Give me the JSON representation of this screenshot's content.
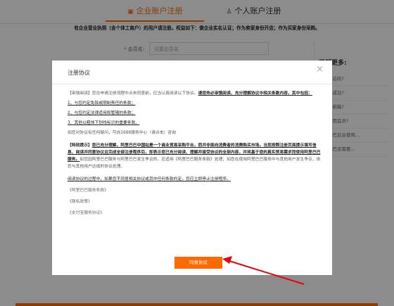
{
  "tabs": {
    "enterprise": "企业账户注册",
    "personal": "个人账户注册"
  },
  "notice": "有企业营业执照（含个体工商户）的用户请注册。权益如下：做企业实名认证；作为卖家身份开店；作为买家身份采购。",
  "form": {
    "required_mark": "*",
    "member_label": "会员名:",
    "member_placeholder": "设置会员名"
  },
  "sidebar": {
    "title": "了解更多:",
    "items": [
      "如何验证码?",
      "注册不成功?",
      "已填写邮箱?",
      "如何使用会员?",
      "阿里巴巴后台使用...",
      "阿里巴巴还需要..."
    ]
  },
  "modal": {
    "title": "注册协议",
    "close": "×",
    "p1_lead": "【审慎阅读】您在申请注册流程中点击同意前，应当认真阅读以下协议。",
    "p1_ul": "请您务必审慎阅读、充分理解协议中相关条款内容，其中包括：",
    "item1": "1、与您约定免除或限制责任的条款；",
    "item2": "2、与您约定法律适用和管辖的条款；",
    "item3": "3、其他以粗体下划线标识的重要条款。",
    "contact": "如您对协议有任何疑问，可向1688服务中心（请点击）咨询",
    "p2_lead": "【特别提示】",
    "p2_ul": "您已充分理解，阿里巴巴中国站是一个商业贸易采购平台，而并非面向消费者的消费购买市场。当您按照注册页面提示填写信息、阅读并同意协议且完成全部注册程序后，即表示您已充分阅读、理解并接受协议的全部内容，并将基于您的真实贸易需求而使用阿里巴巴服务。",
    "p2_tail": "如您因阿里巴巴服务与阿里巴巴发生争议的，应适用《阿里巴巴服务条款》处理；如您在使用阿里巴巴服务中与其他用户发生争议，依您与其他用户达成的协议处理。",
    "p3": "阅读协议的过程中，如果您不同意相关协议或其中任何条款约定，您应立即停止注册程序。",
    "link1": "《阿里巴巴服务条款》",
    "link2": "《隐私政策》",
    "link3": "《支付宝服务协议》",
    "agree": "同意协议"
  },
  "colors": {
    "accent": "#ff6a00",
    "arrow": "#e60012",
    "overlay": "rgba(0,0,0,0.45)"
  },
  "icons": [
    "enterprise-icon",
    "person-icon",
    "close-icon",
    "annotation-arrow"
  ]
}
